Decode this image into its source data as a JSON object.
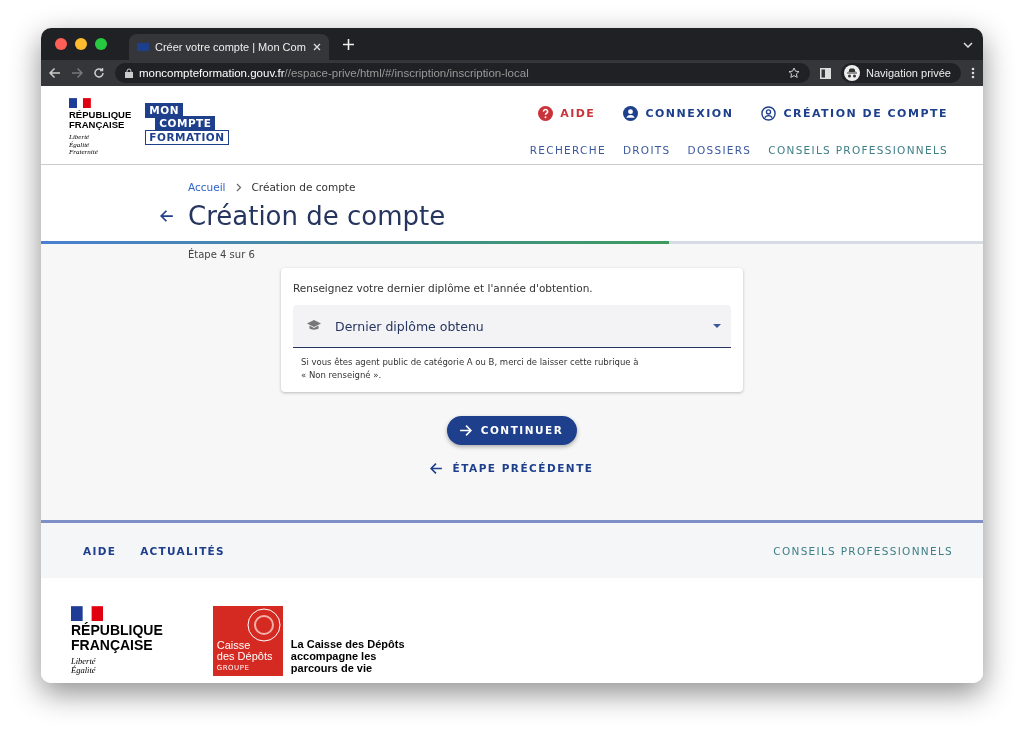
{
  "browser": {
    "tab_title": "Créer votre compte | Mon Com",
    "url_domain": "moncompteformation.gouv.fr",
    "url_path": "//espace-prive/html/#/inscription/inscription-local",
    "profile": "Navigation privée"
  },
  "header": {
    "republic": {
      "name": "RÉPUBLIQUE\nFRANÇAISE",
      "motto": [
        "Liberté",
        "Égalité",
        "Fraternité"
      ]
    },
    "brand": [
      "MON",
      "COMPTE",
      "FORMATION"
    ],
    "top_links": [
      {
        "label": "AIDE",
        "kind": "help"
      },
      {
        "label": "CONNEXION",
        "kind": "login"
      },
      {
        "label": "CRÉATION DE COMPTE",
        "kind": "account"
      }
    ],
    "nav": [
      {
        "label": "RECHERCHE",
        "kind": "main"
      },
      {
        "label": "DROITS",
        "kind": "main"
      },
      {
        "label": "DOSSIERS",
        "kind": "main"
      },
      {
        "label": "CONSEILS PROFESSIONNELS",
        "kind": "pro"
      }
    ]
  },
  "breadcrumb": [
    {
      "label": "Accueil",
      "kind": "link"
    },
    {
      "label": "Création de compte",
      "kind": "current"
    }
  ],
  "page_title": "Création de compte",
  "progress": {
    "level": 0.667,
    "label": "Étape 4 sur 6"
  },
  "form": {
    "intro": "Renseignez votre dernier diplôme et l'année d'obtention.",
    "select": {
      "placeholder": "Dernier diplôme obtenu"
    },
    "hint": "Si vous êtes agent public de catégorie A ou B, merci de laisser cette rubrique à\n« Non renseigné »."
  },
  "buttons": {
    "continue": "CONTINUER",
    "back": "ÉTAPE PRÉCÉDENTE"
  },
  "footer": {
    "links": [
      {
        "label": "AIDE"
      },
      {
        "label": "ACTUALITÉS"
      }
    ],
    "right_link": "CONSEILS PROFESSIONNELS",
    "republic": {
      "name": "RÉPUBLIQUE\nFRANÇAISE",
      "motto": [
        "Liberté",
        "Égalité"
      ]
    },
    "cdc": {
      "logo": [
        "Caisse",
        "des Dépôts"
      ],
      "group": "GROUPE",
      "tagline": "La Caisse des Dépôts\naccompagne les\nparcours de vie"
    }
  }
}
